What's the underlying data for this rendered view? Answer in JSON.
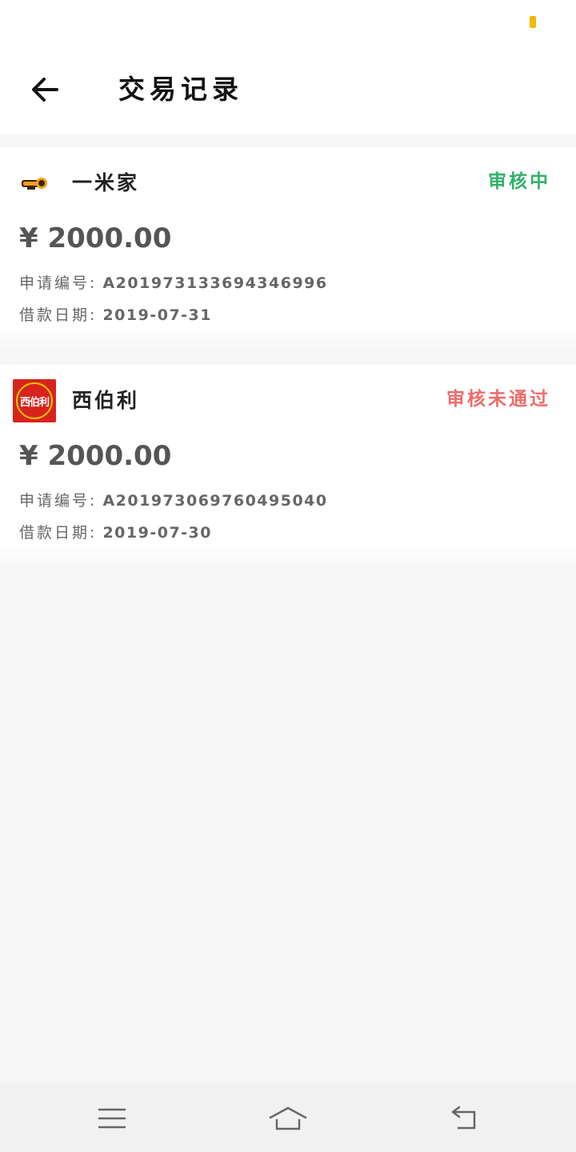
{
  "header": {
    "title": "交易记录"
  },
  "records": [
    {
      "name": "一米家",
      "status": "审核中",
      "status_color": "#2fb26a",
      "amount": "¥ 2000.00",
      "apply_no_label": "申请编号:",
      "apply_no": "A201973133694346996",
      "date_label": "借款日期:",
      "date": "2019-07-31",
      "logo_icon": "yimijia-logo-icon"
    },
    {
      "name": "西伯利",
      "status": "审核未通过",
      "status_color": "#f06b6b",
      "amount": "¥ 2000.00",
      "apply_no_label": "申请编号:",
      "apply_no": "A201973069760495040",
      "date_label": "借款日期:",
      "date": "2019-07-30",
      "logo_icon": "xiboli-logo-icon",
      "logo_text": "西伯利"
    }
  ],
  "navbar": {
    "icons": [
      "menu-icon",
      "home-icon",
      "back-icon"
    ]
  }
}
